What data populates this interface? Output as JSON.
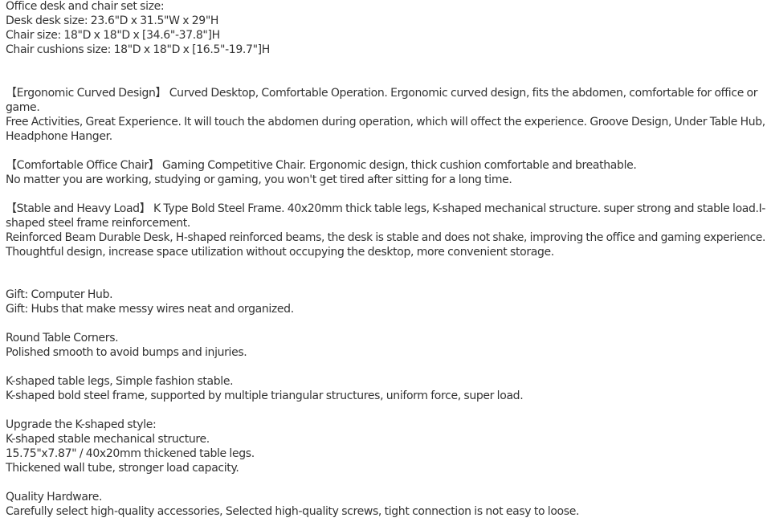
{
  "document": {
    "size_header": [
      "Office desk and chair set size:",
      "Desk desk size: 23.6\"D x 31.5\"W x 29\"H",
      "Chair size: 18\"D x 18\"D x [34.6\"-37.8\"]H",
      "Chair cushions size: 18\"D x 18\"D x [16.5\"-19.7\"]H"
    ],
    "ergonomic": [
      "【Ergonomic Curved Design】 Curved Desktop, Comfortable Operation. Ergonomic curved design, fits the abdomen, comfortable for office or",
      "game.",
      "Free Activities, Great Experience. It will touch the abdomen during operation, which will offect the experience. Groove Design, Under Table Hub,",
      "Headphone Hanger."
    ],
    "chair": [
      "【Comfortable Office Chair】 Gaming Competitive Chair. Ergonomic design, thick cushion comfortable and breathable.",
      "No matter you are working, studying or gaming, you won't get tired after sitting for a long time."
    ],
    "stable": [
      "【Stable and Heavy Load】 K Type Bold Steel Frame. 40x20mm thick table legs, K-shaped mechanical structure. super strong and stable load.I-",
      "shaped steel frame reinforcement.",
      "Reinforced Beam Durable Desk, H-shaped reinforced beams, the desk is stable and does not shake, improving the office and gaming experience.",
      "Thoughtful design, increase space utilization without occupying the desktop, more convenient storage."
    ],
    "gift": [
      "Gift: Computer Hub.",
      "Gift: Hubs that make messy wires neat and organized."
    ],
    "corners": [
      "Round Table Corners.",
      "Polished smooth to avoid bumps and injuries."
    ],
    "legs": [
      "K-shaped table legs, Simple fashion stable.",
      "K-shaped bold steel frame, supported by multiple triangular structures, uniform force, super load."
    ],
    "upgrade": [
      "Upgrade the K-shaped style:",
      "K-shaped stable mechanical structure.",
      "15.75\"x7.87\" / 40x20mm thickened table legs.",
      "Thickened wall tube, stronger load capacity."
    ],
    "hardware": [
      "Quality Hardware.",
      "Carefully select high-quality accessories, Selected high-quality screws, tight connection is not easy to loose."
    ]
  }
}
